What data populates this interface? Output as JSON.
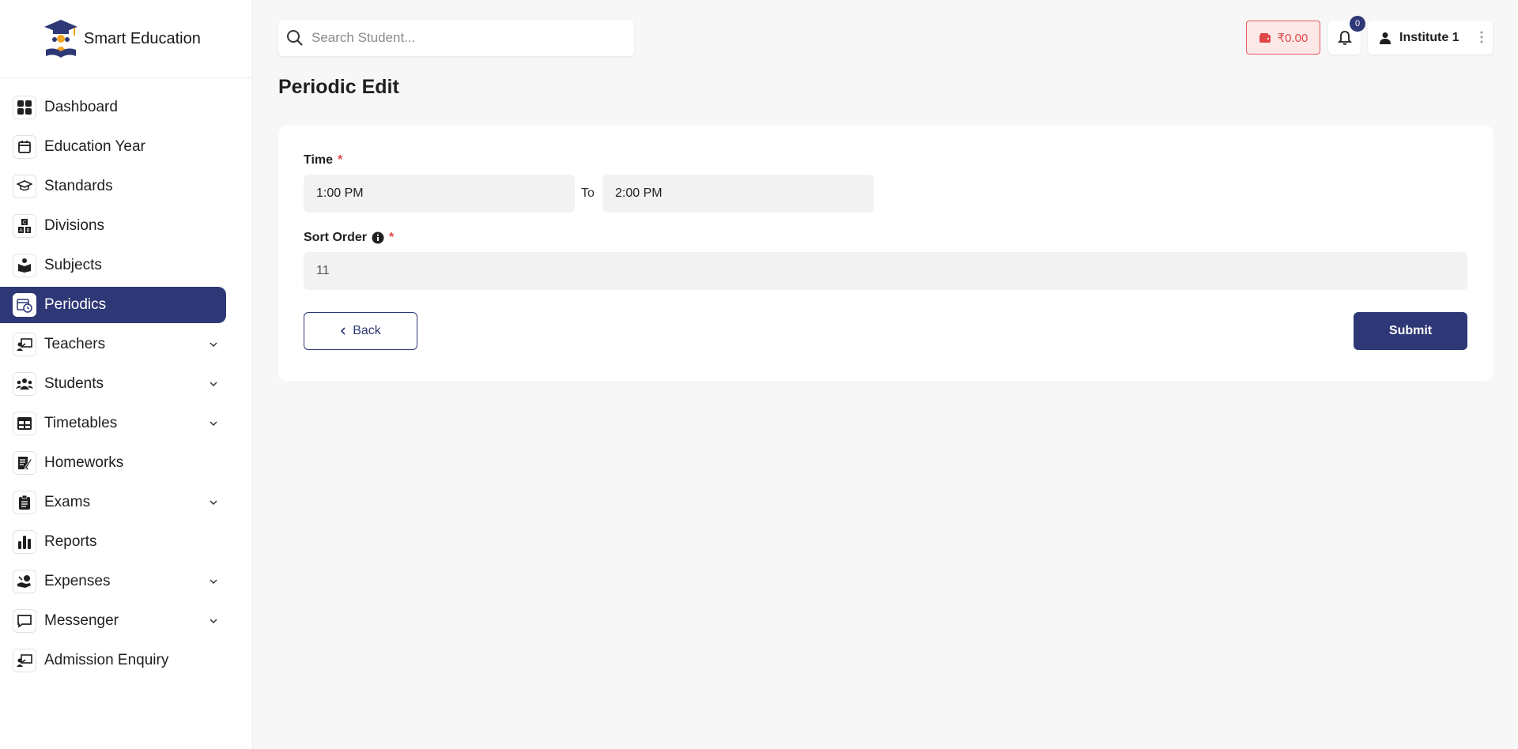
{
  "app": {
    "brand_name": "Smart Education"
  },
  "sidebar": {
    "items": [
      {
        "label": "Dashboard",
        "icon": "grid-icon",
        "expandable": false
      },
      {
        "label": "Education Year",
        "icon": "calendar-icon",
        "expandable": false
      },
      {
        "label": "Standards",
        "icon": "graduation-cap-icon",
        "expandable": false
      },
      {
        "label": "Divisions",
        "icon": "blocks-icon",
        "expandable": false
      },
      {
        "label": "Subjects",
        "icon": "book-reader-icon",
        "expandable": false
      },
      {
        "label": "Periodics",
        "icon": "calendar-clock-icon",
        "expandable": false,
        "active": true
      },
      {
        "label": "Teachers",
        "icon": "teacher-board-icon",
        "expandable": true
      },
      {
        "label": "Students",
        "icon": "users-icon",
        "expandable": true
      },
      {
        "label": "Timetables",
        "icon": "table-icon",
        "expandable": true
      },
      {
        "label": "Homeworks",
        "icon": "note-pen-icon",
        "expandable": false
      },
      {
        "label": "Exams",
        "icon": "clipboard-icon",
        "expandable": true
      },
      {
        "label": "Reports",
        "icon": "bar-chart-icon",
        "expandable": false
      },
      {
        "label": "Expenses",
        "icon": "hand-money-icon",
        "expandable": true
      },
      {
        "label": "Messenger",
        "icon": "chat-icon",
        "expandable": true
      },
      {
        "label": "Admission Enquiry",
        "icon": "teacher-board-icon",
        "expandable": false
      }
    ]
  },
  "header": {
    "search_placeholder": "Search Student...",
    "wallet_amount": "₹0.00",
    "notification_count": "0",
    "user_name": "Institute 1"
  },
  "page": {
    "title": "Periodic Edit"
  },
  "form": {
    "time_label": "Time",
    "required_mark": "*",
    "time_from": "1:00 PM",
    "to_label": "To",
    "time_to": "2:00 PM",
    "sort_order_label": "Sort Order",
    "sort_order_value": "11",
    "back_label": "Back",
    "submit_label": "Submit"
  },
  "colors": {
    "primary": "#2e3876",
    "danger": "#e04848",
    "danger_bg": "#fde8e8"
  }
}
